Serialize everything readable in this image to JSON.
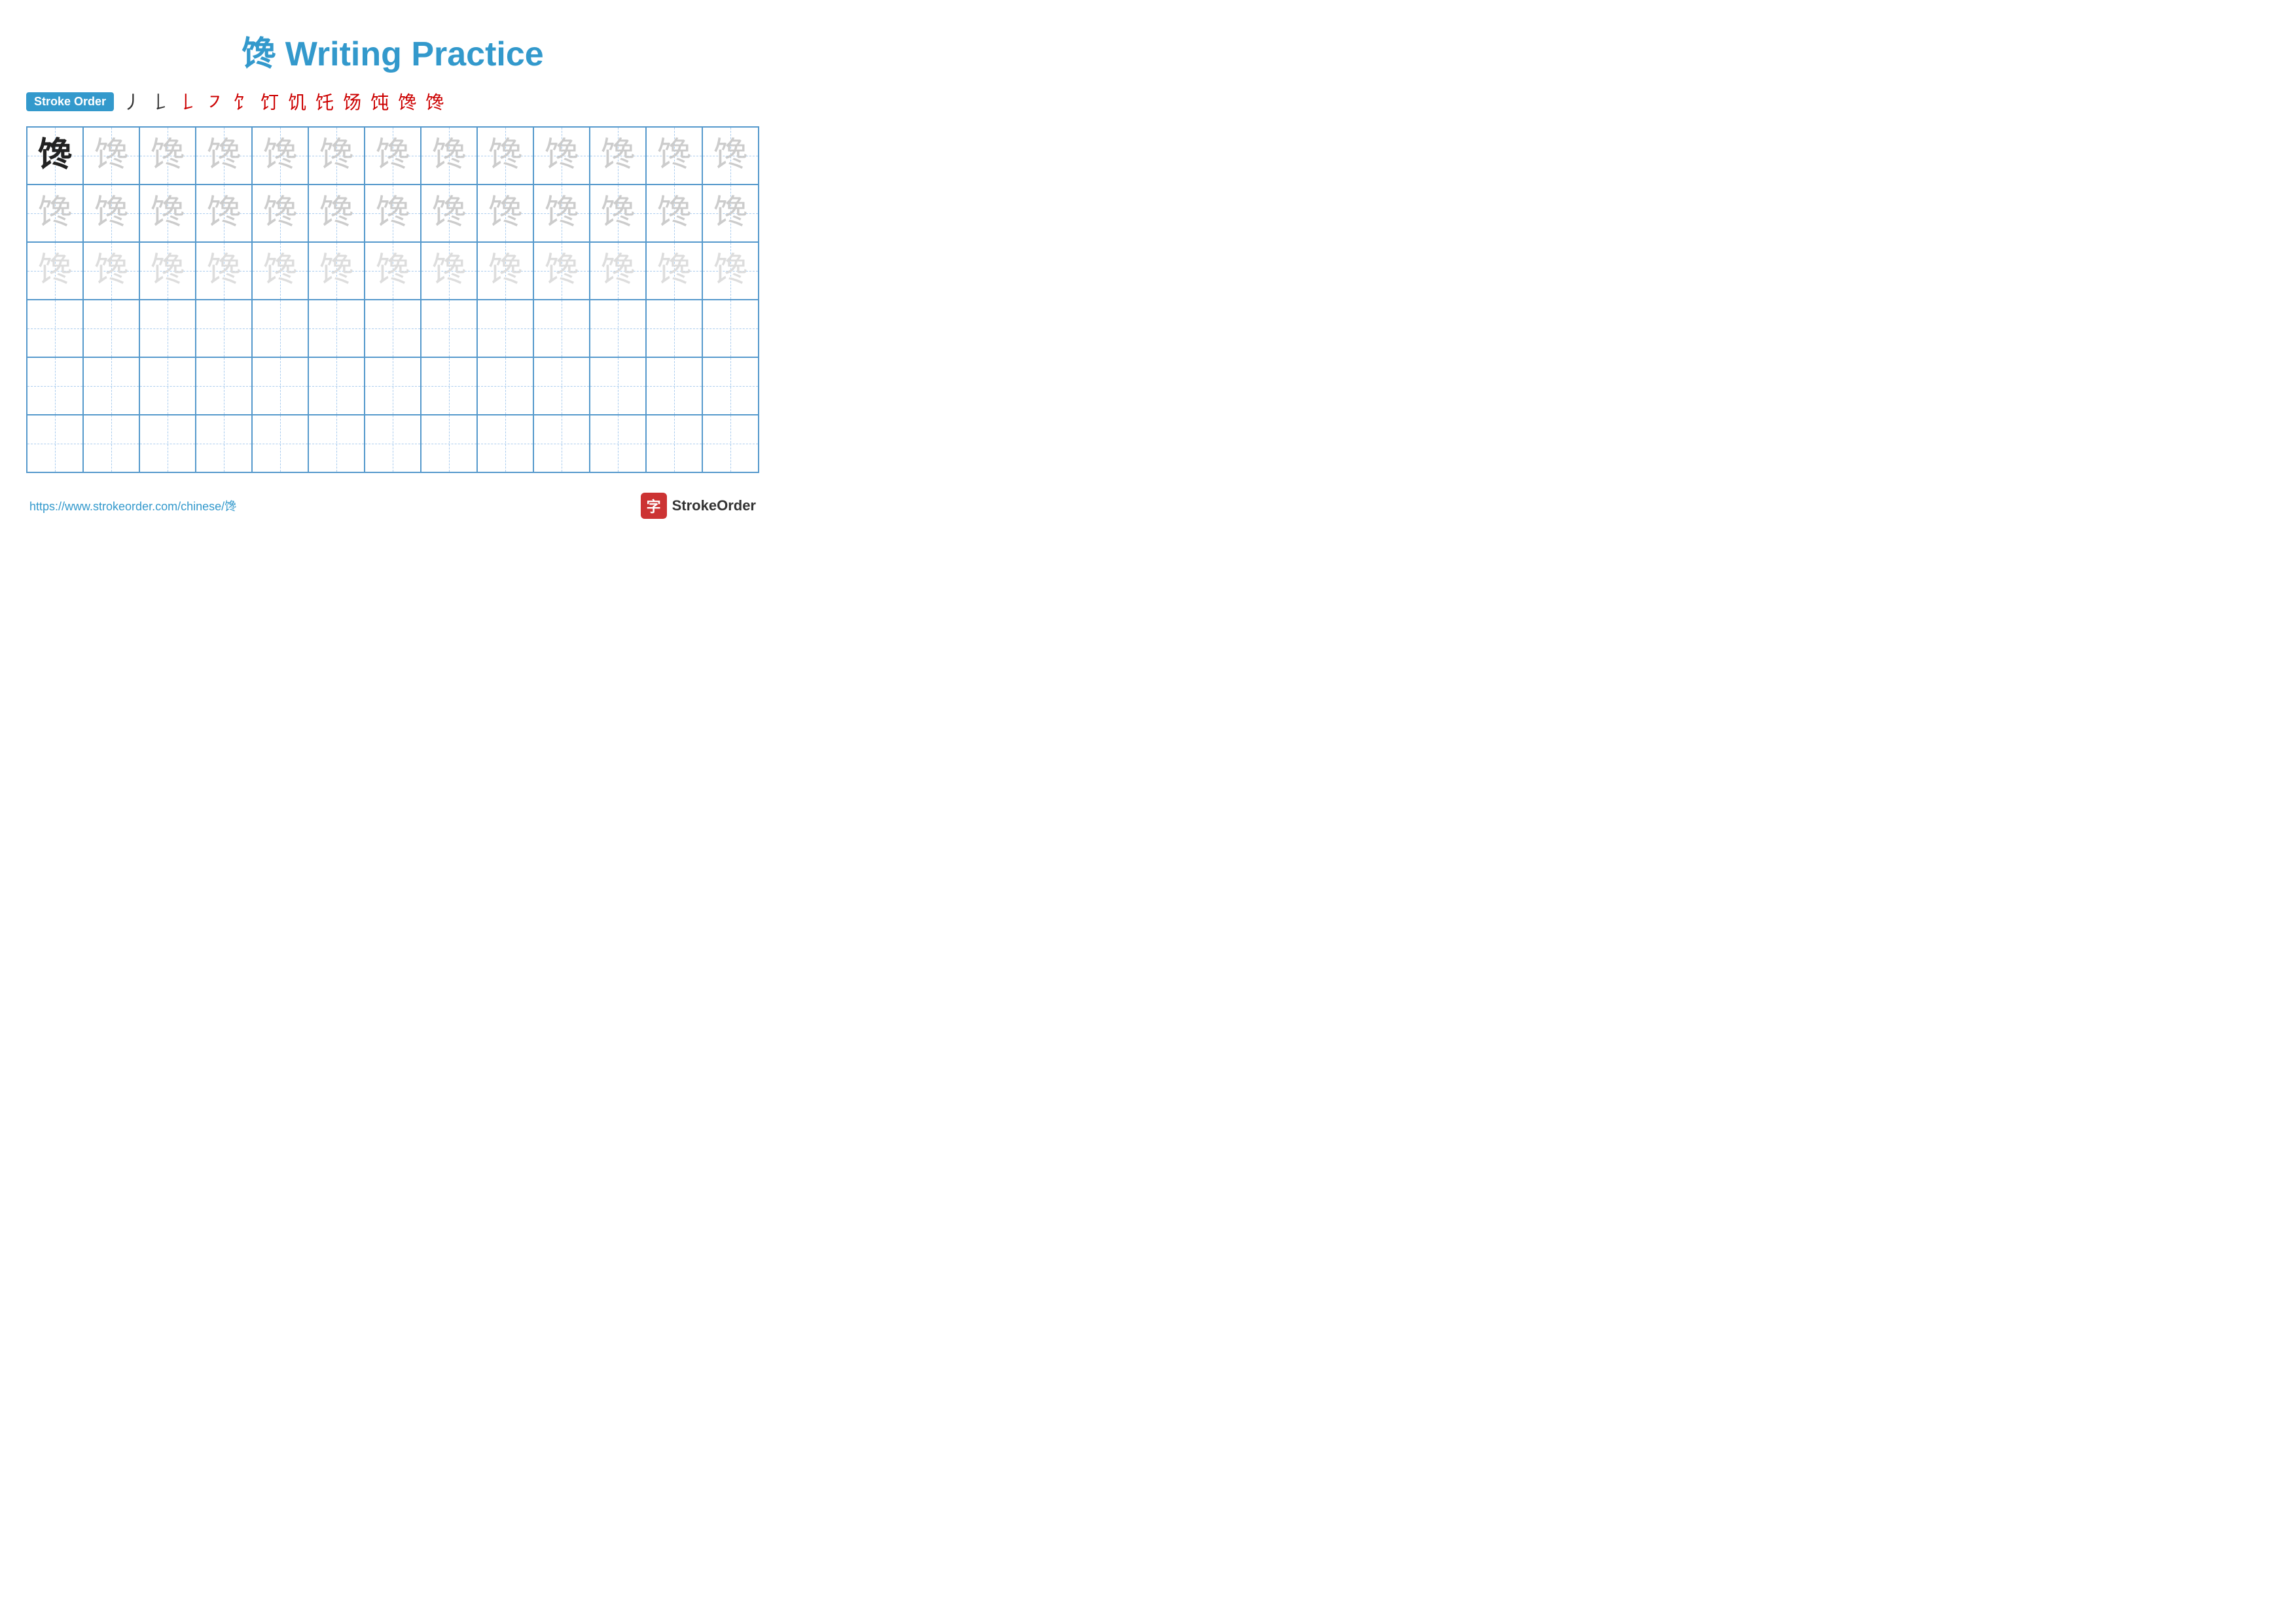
{
  "page": {
    "title": "馋 Writing Practice",
    "title_color": "#3399cc"
  },
  "stroke_order": {
    "badge_label": "Stroke Order",
    "steps": [
      "丿",
      "𠃌",
      "𠃌",
      "㇇",
      "𠃌",
      "𠃌",
      "𠃌",
      "𠃌",
      "𠃌",
      "𠃌",
      "𠃌",
      "馋"
    ]
  },
  "grid": {
    "character": "馋",
    "rows": 6,
    "cols": 13
  },
  "footer": {
    "link_text": "https://www.strokeorder.com/chinese/馋",
    "brand_icon": "字",
    "brand_name": "StrokeOrder"
  }
}
